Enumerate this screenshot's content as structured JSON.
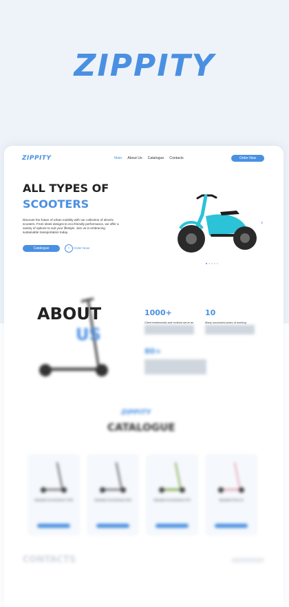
{
  "brand": {
    "logo": "ZIPPITY",
    "accent": "#4a90e2"
  },
  "nav": {
    "logo": "ZIPPITY",
    "links": [
      "Main",
      "About Us",
      "Catalogue",
      "Contacts"
    ],
    "cta": "Order Now"
  },
  "hero": {
    "title_line1": "ALL TYPES OF",
    "title_line2": "SCOOTERS",
    "description": "Discover the future of urban mobility with our collection of electric scooters. From sleek designs to eco-friendly performance, we offer a variety of options to suit your lifestyle. Join us in embracing sustainable transportation today.",
    "catalogue_button": "Catalogue",
    "order_link": "Order Now!",
    "slides_total": 5,
    "slide_active": 1
  },
  "about": {
    "title_line1": "ABOUT",
    "title_line2": "US",
    "stats": [
      {
        "value": "1000+",
        "text": "Client testimonials and reviews serve as"
      },
      {
        "value": "10",
        "text": "Many successful years of working"
      },
      {
        "value": "80+",
        "text": ""
      }
    ]
  },
  "catalogue": {
    "logo": "ZIPPITY",
    "title": "CATALOGUE",
    "products": [
      {
        "name": "Standard Scootzstreet T400",
        "price": ""
      },
      {
        "name": "Standard Scootzstreet S50",
        "price": ""
      },
      {
        "name": "Standard Scootzstreet S70",
        "price": ""
      },
      {
        "name": "Standard Flow 3X",
        "price": ""
      }
    ]
  },
  "contacts": {
    "title": "CONTACTS"
  }
}
